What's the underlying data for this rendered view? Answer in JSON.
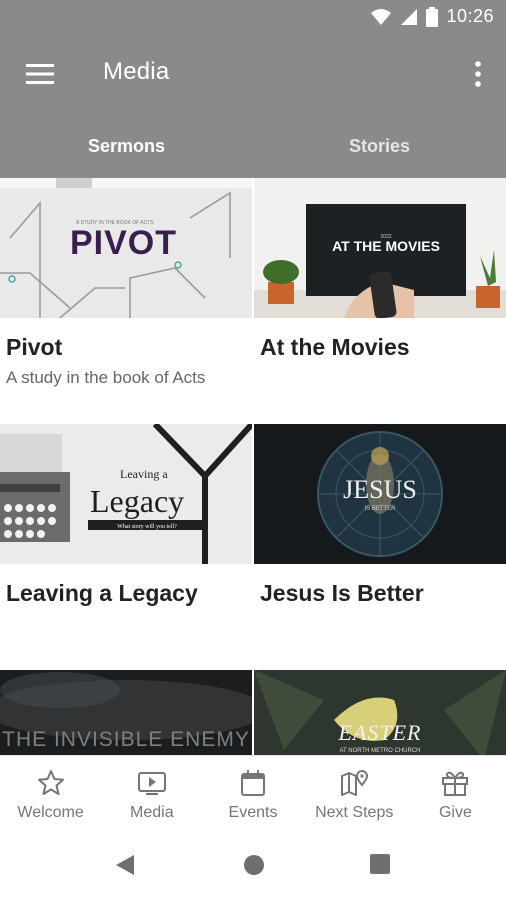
{
  "status_bar": {
    "time": "10:26",
    "icons": [
      "wifi-icon",
      "cell-signal-icon",
      "battery-icon"
    ]
  },
  "app_bar": {
    "title": "Media",
    "menu_icon": "menu-icon",
    "more_icon": "more-vert-icon"
  },
  "tabs": [
    {
      "label": "Sermons",
      "active": true
    },
    {
      "label": "Stories",
      "active": false
    }
  ],
  "series": [
    {
      "title": "Pivot",
      "subtitle": "A study in the book of Acts",
      "art_text": "PIVOT",
      "art_kicker": "A STUDY IN THE BOOK OF ACTS"
    },
    {
      "title": "At the Movies",
      "subtitle": "",
      "art_text": "AT THE MOVIES",
      "art_kicker": "2022"
    },
    {
      "title": "Leaving a Legacy",
      "subtitle": "",
      "art_text": "Legacy",
      "art_kicker": "Leaving a",
      "art_tagline": "What story will you tell?"
    },
    {
      "title": "Jesus Is Better",
      "subtitle": "",
      "art_text": "JESUS",
      "art_kicker": "IS BETTER"
    },
    {
      "title": "",
      "subtitle": "",
      "art_text": "THE INVISIBLE ENEMY"
    },
    {
      "title": "",
      "subtitle": "",
      "art_text": "EASTER",
      "art_kicker": "AT NORTH METRO CHURCH"
    }
  ],
  "bottom_nav": [
    {
      "label": "Welcome",
      "icon": "star-icon"
    },
    {
      "label": "Media",
      "icon": "play-screen-icon"
    },
    {
      "label": "Events",
      "icon": "calendar-icon"
    },
    {
      "label": "Next Steps",
      "icon": "map-pin-icon"
    },
    {
      "label": "Give",
      "icon": "gift-icon"
    }
  ],
  "system_nav": [
    "back-icon",
    "home-icon",
    "recents-icon"
  ],
  "colors": {
    "app_bar": "#8a8a8a",
    "nav_text": "#767676",
    "title_text": "#222222"
  }
}
